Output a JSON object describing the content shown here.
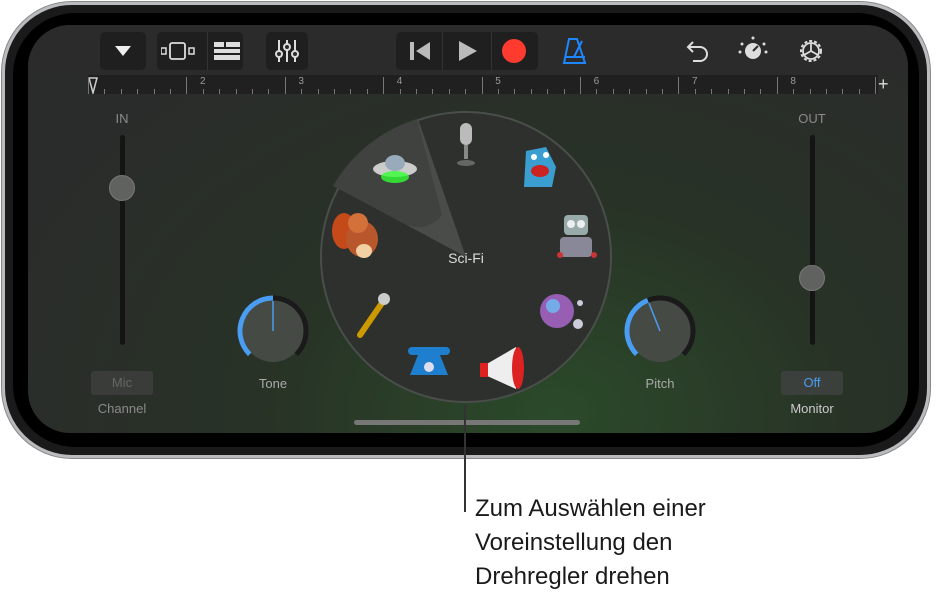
{
  "toolbar": {
    "buttons": [
      "browser-dropdown",
      "tracks-view",
      "mixer-list",
      "controls",
      "rewind",
      "play",
      "record",
      "metronome",
      "undo",
      "master-effects",
      "settings"
    ],
    "record_color": "#ff3b30",
    "metronome_color": "#1e86ff"
  },
  "ruler": {
    "bars": [
      "2",
      "3",
      "4",
      "5",
      "6",
      "7",
      "8"
    ],
    "add_label": "+"
  },
  "input": {
    "label": "IN",
    "level": 0.25,
    "channel_button": "Mic",
    "channel_label": "Channel"
  },
  "output": {
    "label": "OUT",
    "level": 0.68,
    "monitor_button": "Off",
    "monitor_label": "Monitor"
  },
  "knobs": {
    "tone": {
      "label": "Tone",
      "value": 0.5
    },
    "pitch": {
      "label": "Pitch",
      "value": 0.42
    }
  },
  "dial": {
    "selected": "Sci-Fi",
    "presets": [
      "Sci-Fi",
      "Microphone",
      "Monster",
      "Robot",
      "Bubbles",
      "Megaphone",
      "Telephone",
      "Small Mic",
      "Chipmunk"
    ]
  },
  "callout": {
    "lines": [
      "Zum Auswählen einer",
      "Voreinstellung den",
      "Drehregler drehen"
    ]
  },
  "accent": "#4a9df0"
}
